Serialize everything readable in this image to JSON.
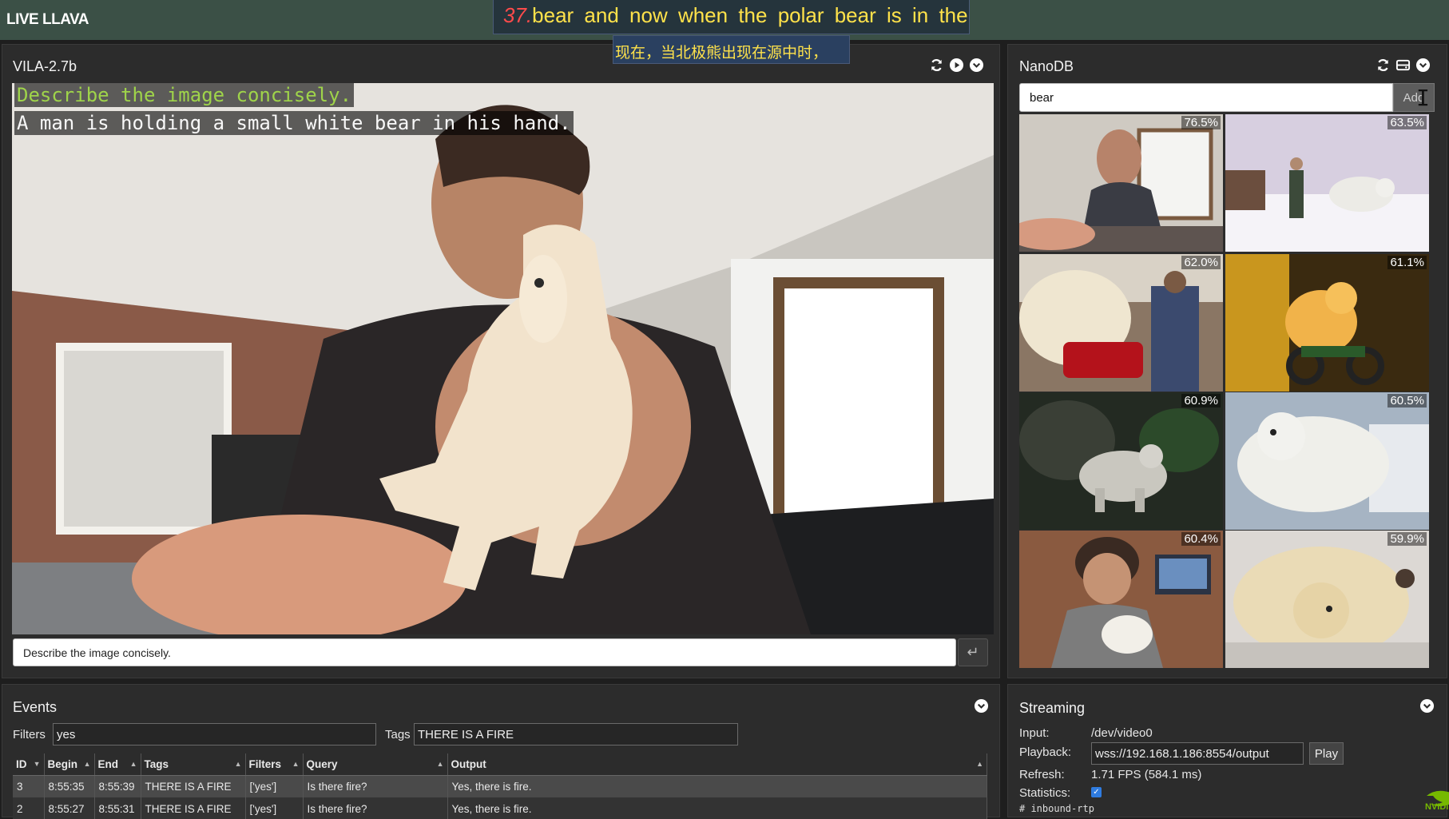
{
  "app": {
    "title": "LIVE LLAVA"
  },
  "subtitles": {
    "number": "37.",
    "english": "bear and now when the polar bear is in the",
    "chinese": "现在，当北极熊出现在源中时，"
  },
  "vila": {
    "title": "VILA-2.7b",
    "icons": [
      "refresh-icon",
      "play-icon",
      "chevron-down-icon"
    ],
    "caption_prompt": "Describe the image concisely.",
    "caption_reply": "A man is holding a small white bear in his hand.",
    "prompt_value": "Describe the image concisely.",
    "enter_glyph": "↵"
  },
  "nanodb": {
    "title": "NanoDB",
    "icons": [
      "refresh-icon",
      "database-icon",
      "chevron-down-icon"
    ],
    "search_value": "bear",
    "add_label": "Add",
    "results": [
      {
        "score": "76.5%"
      },
      {
        "score": "63.5%"
      },
      {
        "score": "62.0%"
      },
      {
        "score": "61.1%"
      },
      {
        "score": "60.9%"
      },
      {
        "score": "60.5%"
      },
      {
        "score": "60.4%"
      },
      {
        "score": "59.9%"
      }
    ]
  },
  "events": {
    "title": "Events",
    "filters_label": "Filters",
    "filters_value": "yes",
    "tags_label": "Tags",
    "tags_value": "THERE IS A FIRE",
    "columns": [
      "ID",
      "Begin",
      "End",
      "Tags",
      "Filters",
      "Query",
      "Output"
    ],
    "rows": [
      {
        "id": "3",
        "begin": "8:55:35",
        "end": "8:55:39",
        "tags": "THERE IS A FIRE",
        "filters": "['yes']",
        "query": "Is there fire?",
        "output": "Yes, there is fire."
      },
      {
        "id": "2",
        "begin": "8:55:27",
        "end": "8:55:31",
        "tags": "THERE IS A FIRE",
        "filters": "['yes']",
        "query": "Is there fire?",
        "output": "Yes, there is fire."
      }
    ]
  },
  "streaming": {
    "title": "Streaming",
    "input_label": "Input:",
    "input_value": "/dev/video0",
    "playback_label": "Playback:",
    "playback_value": "wss://192.168.1.186:8554/output",
    "play_label": "Play",
    "refresh_label": "Refresh:",
    "refresh_value": "1.71 FPS (584.1 ms)",
    "statistics_label": "Statistics:",
    "statistics_checked": true,
    "rtp_text": "# inbound-rtp"
  },
  "branding": {
    "logo_text": "NVIDI"
  },
  "colors": {
    "topbar": "#3b5046",
    "panel": "#2c2c2c",
    "subtitle_text": "#ffe24a",
    "prompt_caption": "#9fd44a",
    "accent_blue": "#2f7ce0",
    "nvidia_green": "#76b900"
  }
}
